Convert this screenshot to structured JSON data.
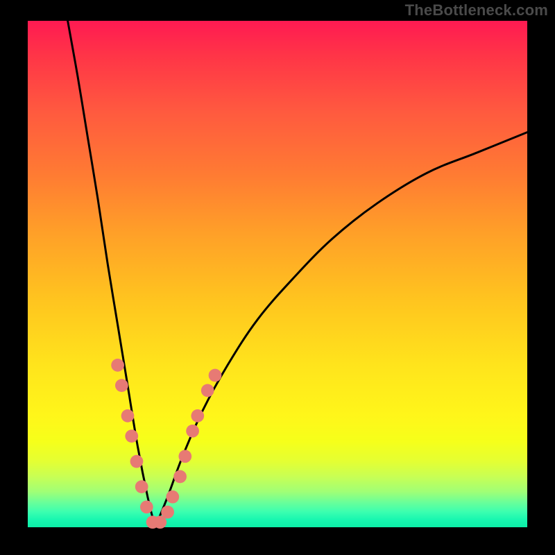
{
  "watermark": "TheBottleneck.com",
  "colors": {
    "frame_background": "#000000",
    "watermark_text": "#4a4a4a",
    "curve_stroke": "#000000",
    "marker_fill": "#e77a74",
    "gradient_top": "#ff1a52",
    "gradient_bottom": "#0ceea8"
  },
  "chart_data": {
    "type": "line",
    "title": "",
    "xlabel": "",
    "ylabel": "",
    "xlim": [
      0,
      100
    ],
    "ylim": [
      0,
      100
    ],
    "grid": false,
    "legend": false,
    "description": "Two smooth curves over a rainbow gradient from red (top/100) to green (bottom/0). One curve descends steeply from the top-left from y≈100 at x≈8 down to y≈0 near x≈25. The second curve rises from y≈0 near x≈25 up to the top-right reaching y≈78 at x=100. A cluster of salmon-colored round markers sits in the lower band (roughly y between 0 and 30) along both curves near x 18–38, forming a V shape.",
    "series": [
      {
        "name": "left_descending_curve",
        "x": [
          8,
          10,
          12,
          14,
          16,
          18,
          20,
          22,
          24,
          25.5
        ],
        "y": [
          100,
          89,
          77,
          65,
          52,
          40,
          28,
          16,
          6,
          0
        ]
      },
      {
        "name": "right_ascending_curve",
        "x": [
          25.5,
          28,
          31,
          35,
          40,
          46,
          53,
          61,
          70,
          80,
          90,
          100
        ],
        "y": [
          0,
          6,
          14,
          23,
          32,
          41,
          49,
          57,
          64,
          70,
          74,
          78
        ]
      }
    ],
    "markers": [
      {
        "x": 18.0,
        "y": 32
      },
      {
        "x": 18.8,
        "y": 28
      },
      {
        "x": 20.0,
        "y": 22
      },
      {
        "x": 20.8,
        "y": 18
      },
      {
        "x": 21.8,
        "y": 13
      },
      {
        "x": 22.8,
        "y": 8
      },
      {
        "x": 23.8,
        "y": 4
      },
      {
        "x": 25.0,
        "y": 1
      },
      {
        "x": 26.5,
        "y": 1
      },
      {
        "x": 28.0,
        "y": 3
      },
      {
        "x": 29.0,
        "y": 6
      },
      {
        "x": 30.5,
        "y": 10
      },
      {
        "x": 31.5,
        "y": 14
      },
      {
        "x": 33.0,
        "y": 19
      },
      {
        "x": 34.0,
        "y": 22
      },
      {
        "x": 36.0,
        "y": 27
      },
      {
        "x": 37.5,
        "y": 30
      }
    ],
    "marker_radius_data_units": 1.3
  }
}
